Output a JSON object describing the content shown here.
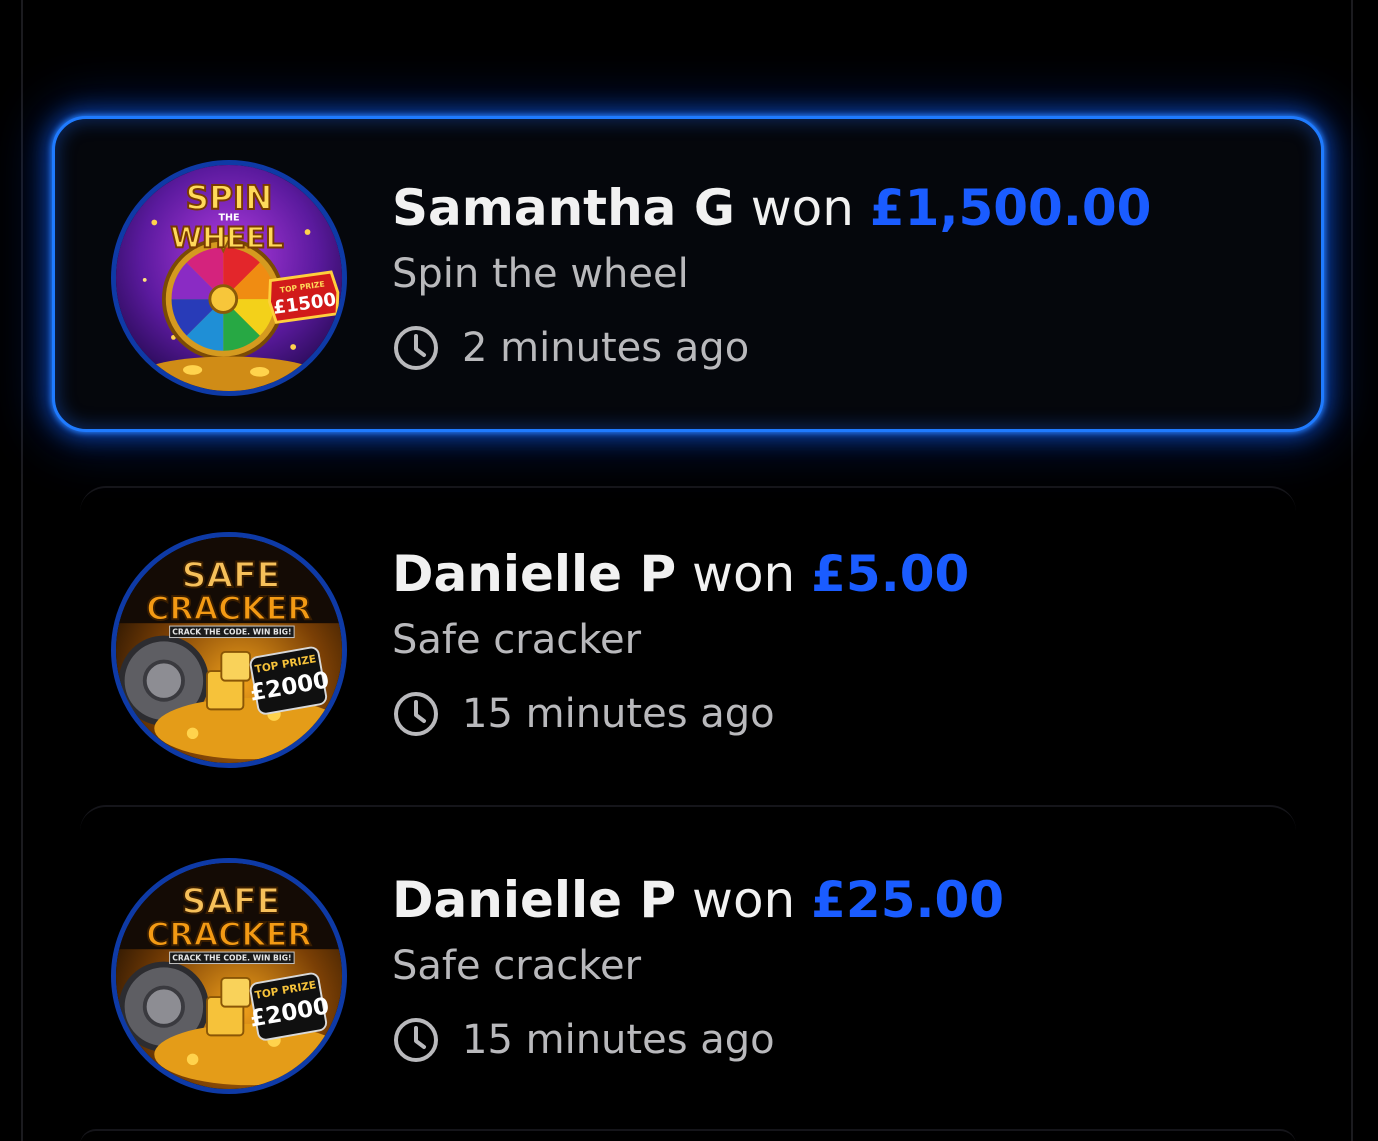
{
  "winners": [
    {
      "player": "Samantha G",
      "won_word": "won",
      "amount": "£1,500.00",
      "game": "Spin the wheel",
      "time_ago": "2 minutes ago",
      "thumbnail": {
        "icon": "spin-the-wheel-game-art",
        "title_top": "SPIN",
        "title_mid": "THE",
        "title_bottom": "WHEEL",
        "badge_top": "TOP PRIZE",
        "badge_value": "£1500"
      },
      "highlighted": true
    },
    {
      "player": "Danielle P",
      "won_word": "won",
      "amount": "£5.00",
      "game": "Safe cracker",
      "time_ago": "15 minutes ago",
      "thumbnail": {
        "icon": "safe-cracker-game-art",
        "title_top": "SAFE",
        "title_bottom": "CRACKER",
        "tagline": "CRACK THE CODE. WIN BIG!",
        "badge_top": "TOP PRIZE",
        "badge_value": "£2000"
      },
      "highlighted": false
    },
    {
      "player": "Danielle P",
      "won_word": "won",
      "amount": "£25.00",
      "game": "Safe cracker",
      "time_ago": "15 minutes ago",
      "thumbnail": {
        "icon": "safe-cracker-game-art",
        "title_top": "SAFE",
        "title_bottom": "CRACKER",
        "tagline": "CRACK THE CODE. WIN BIG!",
        "badge_top": "TOP PRIZE",
        "badge_value": "£2000"
      },
      "highlighted": false
    }
  ],
  "colors": {
    "background": "#000000",
    "accent_blue": "#1a5cff",
    "glow_blue": "#1f7bff",
    "text_primary": "#f1f1f1",
    "text_secondary": "#b9b9bc"
  }
}
